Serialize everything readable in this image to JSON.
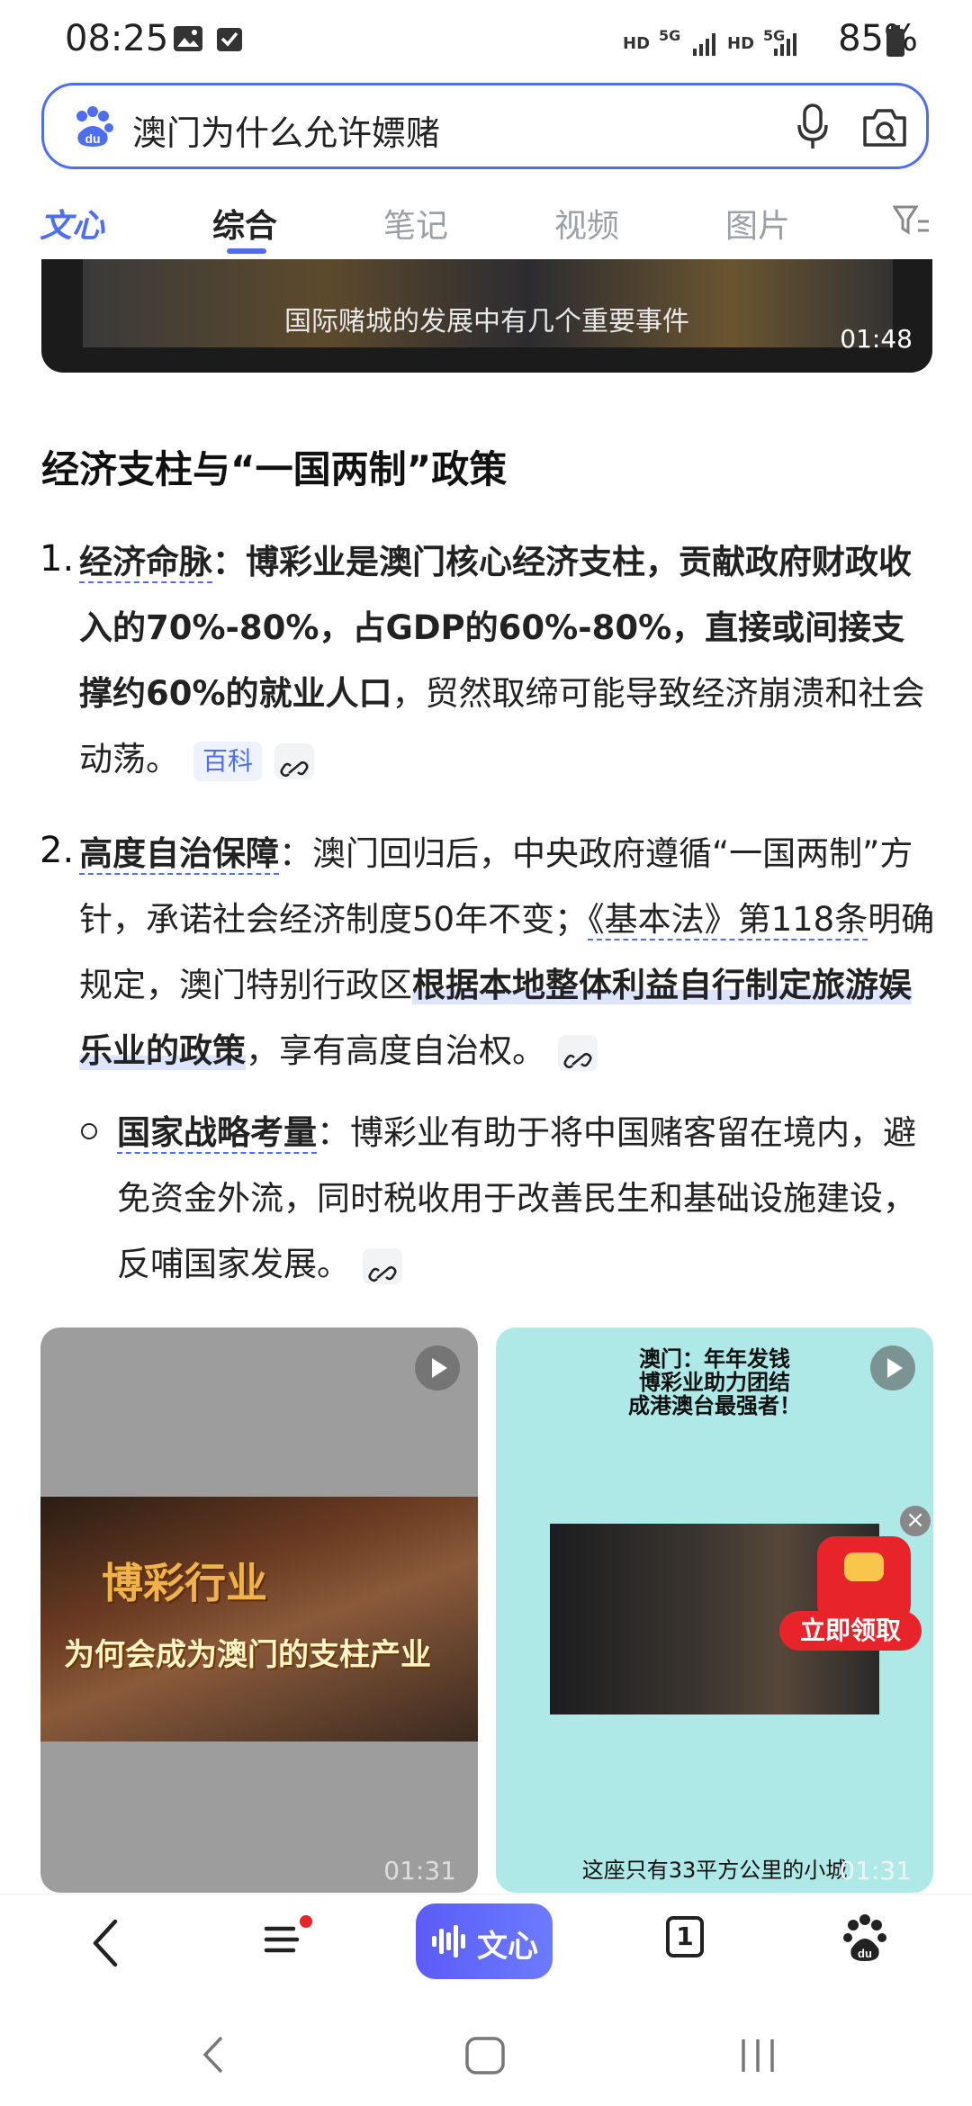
{
  "status_bar": {
    "time": "08:25",
    "network_labels": [
      "HD",
      "5G",
      "HD",
      "5G"
    ],
    "battery": "85%"
  },
  "search": {
    "query": "澳门为什么允许嫖赌"
  },
  "tabs": [
    {
      "label": "文心"
    },
    {
      "label": "综合"
    },
    {
      "label": "笔记"
    },
    {
      "label": "视频"
    },
    {
      "label": "图片"
    }
  ],
  "top_video": {
    "caption": "国际赌城的发展中有几个重要事件",
    "duration": "01:48"
  },
  "article": {
    "heading": "经济支柱与“一国两制”政策",
    "item1": {
      "number": "1.",
      "title": "经济命脉",
      "colon": "：",
      "bold_text": "博彩业是澳门核心经济支柱，贡献政府财政收入的70%-80%，占GDP的60%-80%，直接或间接支撑约60%的就业人口",
      "rest": "，贸然取缔可能导致经济崩溃和社会动荡。",
      "chip": "百科"
    },
    "item2": {
      "number": "2.",
      "title": "高度自治保障",
      "text_a": "：澳门回归后，中央政府遵循“一国两制”方针，承诺社会经济制度50年不变；",
      "law_ref": "《基本法》第118条",
      "text_b": "明确规定，澳门特别行政区",
      "bold_text": "根据本地整体利益自行制定旅游娱乐业的政策",
      "text_c": "，享有高度自治权。"
    },
    "sub_item": {
      "title": "国家战略考量",
      "text": "：博彩业有助于将中国赌客留在境内，避免资金外流，同时税收用于改善民生和基础设施建设，反哺国家发展。"
    }
  },
  "cards": [
    {
      "title_line1": "博彩行业",
      "title_line2": "为何会成为澳门的支柱产业",
      "duration": "01:31"
    },
    {
      "caption_top": "澳门：年年发钱\n博彩业助力团结\n成港澳台最强者！",
      "caption_bottom": "这座只有33平方公里的小城",
      "duration": "01:31"
    }
  ],
  "promo": {
    "claim_label": "立即领取",
    "close": "×"
  },
  "bottom_nav": {
    "wenxin_label": "文心",
    "tab_count": "1"
  }
}
